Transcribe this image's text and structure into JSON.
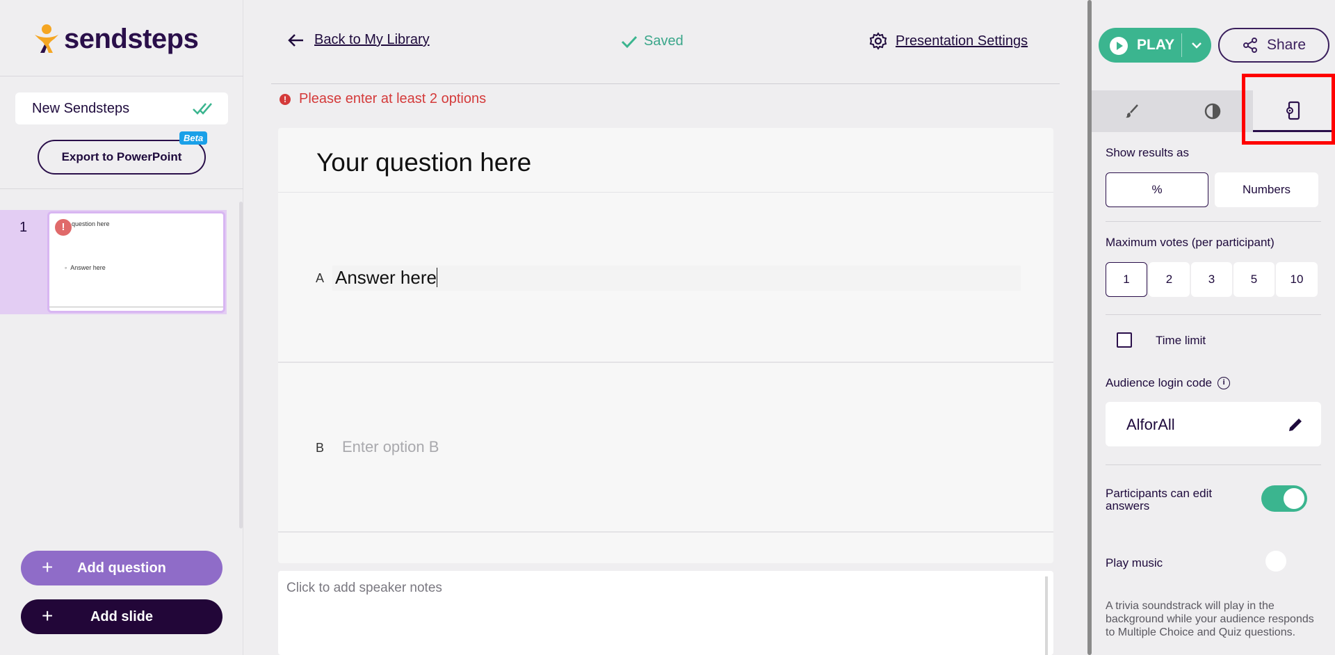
{
  "brand": {
    "name": "sendsteps"
  },
  "sidebar": {
    "presentation_title": "New Sendsteps",
    "export_label": "Export to PowerPoint",
    "beta_label": "Beta",
    "slides": [
      {
        "number": "1",
        "question": "question here",
        "answer": "Answer here",
        "has_error": true,
        "error_glyph": "!"
      }
    ],
    "add_question_label": "Add question",
    "add_slide_label": "Add slide",
    "plus_glyph": "+"
  },
  "header": {
    "back_label": "Back to My Library",
    "saved_label": "Saved",
    "settings_label": "Presentation Settings"
  },
  "editor": {
    "error_message": "Please enter at least 2 options",
    "error_glyph": "!",
    "question_title": "Your question here",
    "options": [
      {
        "letter": "A",
        "value": "Answer here",
        "placeholder": ""
      },
      {
        "letter": "B",
        "value": "",
        "placeholder": "Enter option B"
      }
    ],
    "speaker_notes_placeholder": "Click to add speaker notes"
  },
  "right_panel": {
    "play_label": "PLAY",
    "share_label": "Share",
    "tabs": [
      {
        "name": "design",
        "icon": "paintbrush-icon",
        "active": false
      },
      {
        "name": "theme",
        "icon": "contrast-icon",
        "active": false
      },
      {
        "name": "audience-settings",
        "icon": "phone-settings-icon",
        "active": true
      }
    ],
    "show_results_label": "Show results as",
    "show_results_options": [
      {
        "label": "%",
        "selected": true
      },
      {
        "label": "Numbers",
        "selected": false
      }
    ],
    "max_votes_label": "Maximum votes (per participant)",
    "max_votes_options": [
      {
        "label": "1",
        "selected": true
      },
      {
        "label": "2",
        "selected": false
      },
      {
        "label": "3",
        "selected": false
      },
      {
        "label": "5",
        "selected": false
      },
      {
        "label": "10",
        "selected": false
      }
    ],
    "time_limit_label": "Time limit",
    "time_limit_checked": false,
    "login_code_label": "Audience login code",
    "info_glyph": "i",
    "login_code": "AlforAll",
    "edit_answers_label": "Participants can edit answers",
    "edit_answers_on": true,
    "play_music_label": "Play music",
    "play_music_on": false,
    "play_music_description": "A trivia soundstrack will play in the background while your audience responds to Multiple Choice and Quiz questions."
  },
  "colors": {
    "accent_green": "#3bb58f",
    "brand_purple": "#2a0f4a",
    "add_question_purple": "#8f6cc8",
    "error_red": "#d43a3a",
    "highlight_red": "#ff0000"
  }
}
